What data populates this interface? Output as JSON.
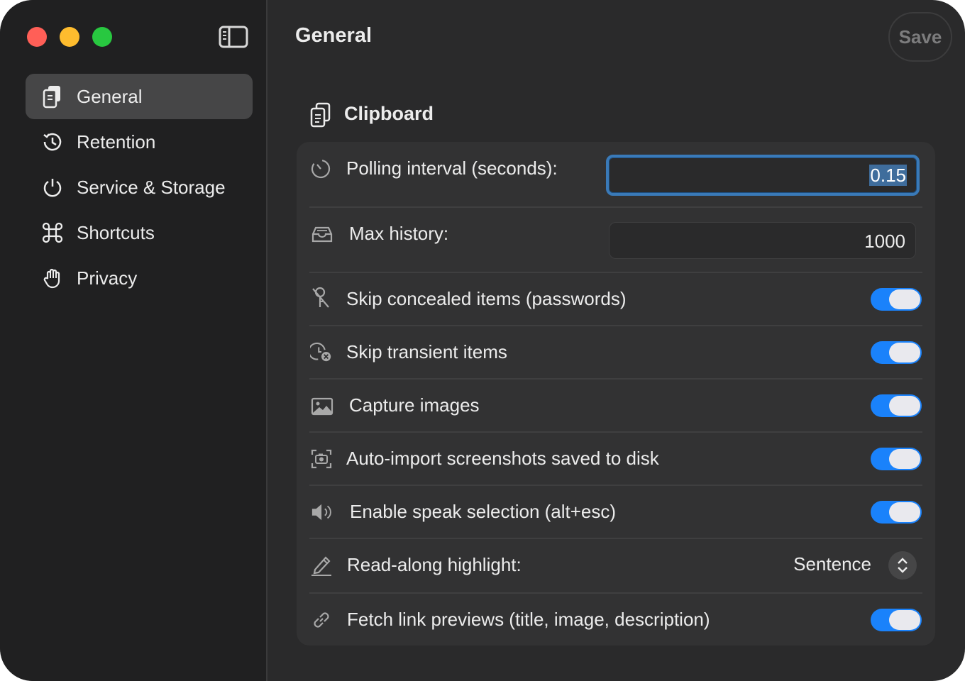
{
  "window": {
    "title": "General",
    "save_label": "Save"
  },
  "sidebar": {
    "items": [
      {
        "label": "General",
        "icon": "clipboard-icon",
        "active": true
      },
      {
        "label": "Retention",
        "icon": "history-icon",
        "active": false
      },
      {
        "label": "Service & Storage",
        "icon": "power-icon",
        "active": false
      },
      {
        "label": "Shortcuts",
        "icon": "command-icon",
        "active": false
      },
      {
        "label": "Privacy",
        "icon": "hand-icon",
        "active": false
      }
    ]
  },
  "section": {
    "title": "Clipboard",
    "icon": "clipboard-icon"
  },
  "settings": {
    "polling": {
      "label": "Polling interval (seconds):",
      "value": "0.15",
      "icon": "timer-icon"
    },
    "max_history": {
      "label": "Max history:",
      "value": "1000",
      "icon": "tray-icon"
    },
    "skip_concealed": {
      "label": "Skip concealed items (passwords)",
      "on": true,
      "icon": "key-slash-icon"
    },
    "skip_transient": {
      "label": "Skip transient items",
      "on": true,
      "icon": "clock-x-icon"
    },
    "capture_images": {
      "label": "Capture images",
      "on": true,
      "icon": "photo-icon"
    },
    "auto_import": {
      "label": "Auto-import screenshots saved to disk",
      "on": true,
      "icon": "camera-viewfinder-icon"
    },
    "speak_selection": {
      "label": "Enable speak selection (alt+esc)",
      "on": true,
      "icon": "speaker-icon"
    },
    "read_along": {
      "label": "Read-along highlight:",
      "value": "Sentence",
      "icon": "pencil-icon"
    },
    "link_previews": {
      "label": "Fetch link previews (title, image, description)",
      "on": true,
      "icon": "link-icon"
    }
  },
  "colors": {
    "accent": "#1a82fb",
    "window_bg": "#2a2a2b",
    "sidebar_bg": "#202021",
    "panel_bg": "#323233",
    "focus_ring": "#3a7ab8"
  }
}
